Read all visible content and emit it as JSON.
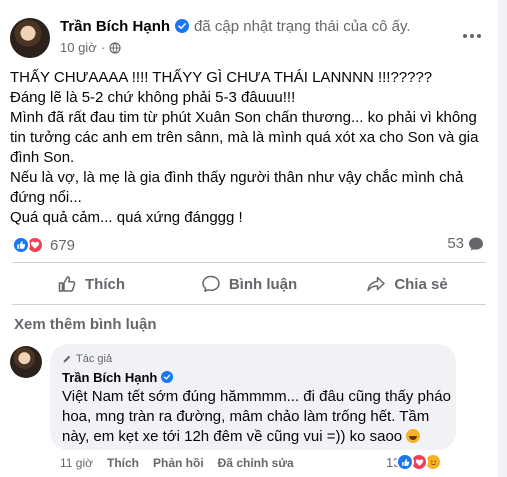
{
  "post": {
    "author": "Trần Bích Hạnh",
    "status": "đã cập nhật trạng thái của cô ấy.",
    "time": "10 giờ",
    "dot": "·",
    "lines": [
      "THẤY CHƯAAAA !!!! THẤYY GÌ CHƯA THÁI LANNNN !!!?????",
      "Đáng lẽ là 5-2 chứ không phải 5-3 đâuuu!!!",
      "Mình đã rất đau tim từ phút Xuân Son chấn thương... ko phải vì không tin tưởng các anh em trên sânn, mà là mình quá xót xa cho Son và gia đình Son.",
      "Nếu là vợ, là mẹ là gia đình thấy người thân như vậy chắc mình chả đứng nổi...",
      "Quá quả cảm... quá xứng đánggg !"
    ],
    "reaction_count": "679",
    "comment_count": "53"
  },
  "actions": {
    "like": "Thích",
    "comment": "Bình luận",
    "share": "Chia sẻ"
  },
  "see_more_comments": "Xem thêm bình luận",
  "comment": {
    "badge": "Tác giả",
    "author": "Trần Bích Hạnh",
    "text": "Việt Nam tết sớm đúng hămmmm... đi đâu cũng thấy pháo hoa, mng tràn ra đường, mâm chảo làm trống hết. Tầm này, em kẹt xe tới 12h đêm về cũng vui =)) ko saoo",
    "time": "11 giờ",
    "like": "Thích",
    "reply": "Phản hồi",
    "edited": "Đã chỉnh sửa",
    "reaction_count": "13"
  },
  "icons": {
    "verified": "verified-badge-icon",
    "privacy": "friends-globe-icon",
    "more": "more-options-icon",
    "like": "thumbs-up-icon",
    "comment": "comment-bubble-icon",
    "share": "share-arrow-icon"
  },
  "colors": {
    "accent": "#1877f2",
    "love": "#f33e58",
    "secondary_text": "#65676b"
  }
}
